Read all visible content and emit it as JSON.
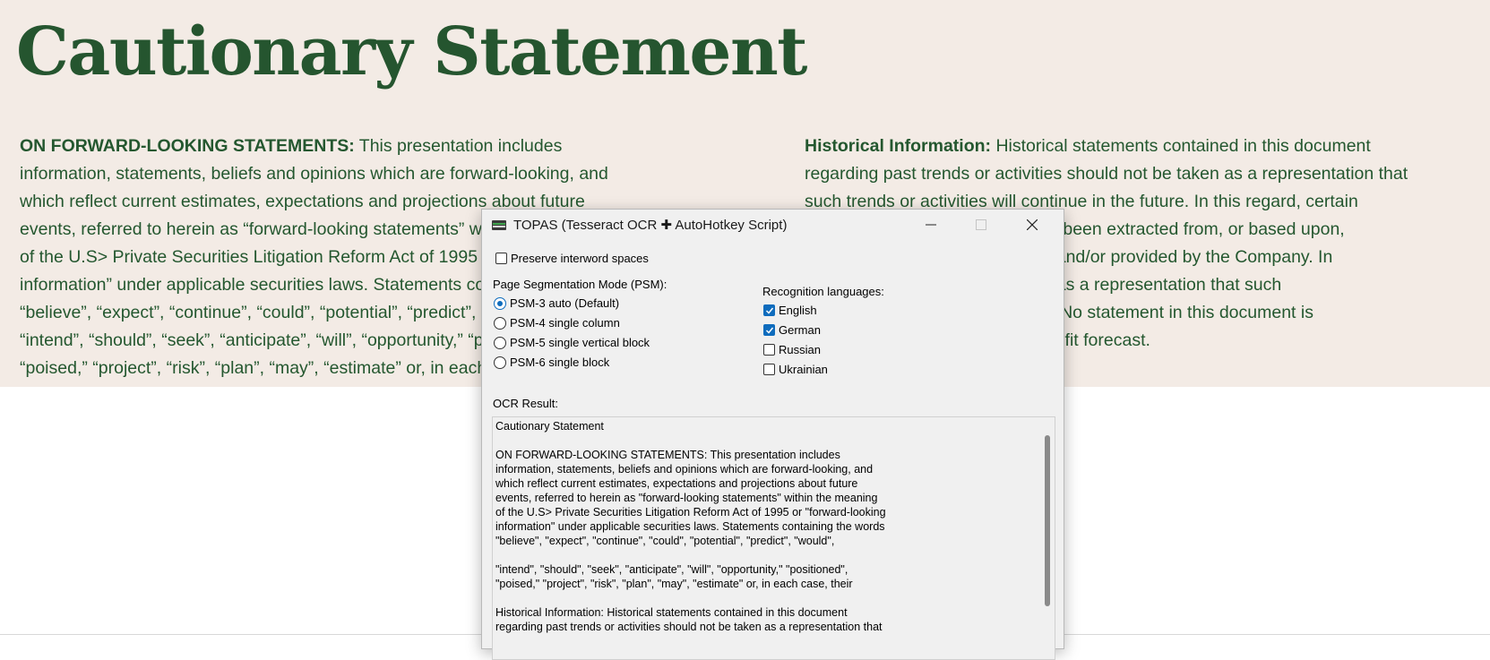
{
  "document": {
    "title": "Cautionary Statement",
    "left_heading": "ON FORWARD-LOOKING STATEMENTS:",
    "left_lines": [
      " This presentation includes",
      "information, statements, beliefs and opinions which are forward-looking, and",
      "which reflect current estimates, expectations and projections about future",
      "events, referred to herein as “forward-looking statements” within the meaning",
      "of the U.S> Private Securities Litigation Reform Act of 1995 or “forward-looking",
      "information” under applicable securities laws. Statements containing the words",
      "“believe”, “expect”, “continue”, “could”, “potential”, “predict”, “would”,",
      "“intend”, “should”, “seek”, “anticipate”, “will”, “opportunity,” “positioned”,",
      "“poised,” “project”, “risk”, “plan”, “may”, “estimate” or, in each case, their"
    ],
    "right_heading": "Historical Information:",
    "right_lines": [
      " Historical statements contained in this document",
      "regarding past trends or activities should not be taken as a representation that",
      "such trends or activities will continue in the future. In this regard, certain",
      "information contained herein has been extracted from, or based upon,",
      "information in the public domain and/or provided by the Company. In",
      "particular, it should not be taken as a representation that such",
      "trends will continue in the future. No statement in this document is",
      "intended to be construed as a profit forecast."
    ]
  },
  "dialog": {
    "title": "TOPAS (Tesseract OCR ✚ AutoHotkey Script)",
    "preserve_spaces": {
      "label": "Preserve interword spaces",
      "checked": false
    },
    "psm": {
      "label": "Page Segmentation Mode (PSM):",
      "options": [
        {
          "label": "PSM-3 auto (Default)",
          "selected": true
        },
        {
          "label": "PSM-4 single column",
          "selected": false
        },
        {
          "label": "PSM-5 single vertical block",
          "selected": false
        },
        {
          "label": "PSM-6 single block",
          "selected": false
        }
      ]
    },
    "languages": {
      "label": "Recognition languages:",
      "options": [
        {
          "label": "English",
          "checked": true
        },
        {
          "label": "German",
          "checked": true
        },
        {
          "label": "Russian",
          "checked": false
        },
        {
          "label": "Ukrainian",
          "checked": false
        }
      ]
    },
    "ocr_label": "OCR Result:",
    "ocr_text": "Cautionary Statement\n\nON FORWARD-LOOKING STATEMENTS: This presentation includes\ninformation, statements, beliefs and opinions which are forward-looking, and\nwhich reflect current estimates, expectations and projections about future\nevents, referred to herein as \"forward-looking statements\" within the meaning\nof the U.S> Private Securities Litigation Reform Act of 1995 or \"forward-looking\ninformation\" under applicable securities laws. Statements containing the words\n\"believe\", \"expect\", \"continue\", \"could\", \"potential\", \"predict\", \"would\",\n\n\"intend\", \"should\", \"seek\", \"anticipate\", \"will\", \"opportunity,\" \"positioned\",\n\"poised,\" \"project\", \"risk\", \"plan\", \"may\", \"estimate\" or, in each case, their\n\nHistorical Information: Historical statements contained in this document\nregarding past trends or activities should not be taken as a representation that"
  },
  "colors": {
    "doc_background": "#f3ebe5",
    "doc_text": "#24572f",
    "accent": "#0f6cbd"
  }
}
